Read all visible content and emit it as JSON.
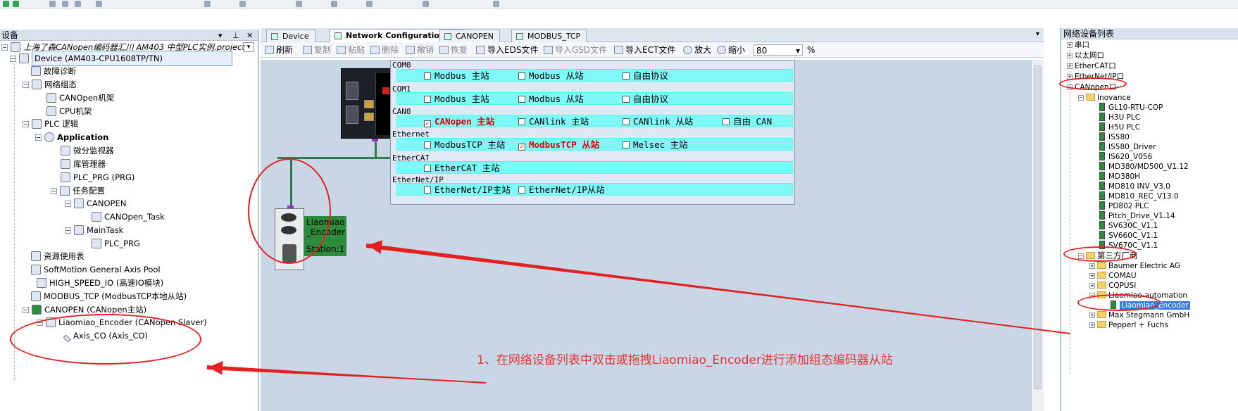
{
  "left": {
    "title": "设备",
    "project": "上海了森CANopen编码器汇川 AM403 中型PLC实例.project",
    "items": [
      {
        "label": "Device (AM403-CPU1608TP/TN)"
      },
      {
        "label": "故障诊断"
      },
      {
        "label": "网络组态"
      },
      {
        "label": "CANOpen机架"
      },
      {
        "label": "CPU机架"
      },
      {
        "label": "PLC 逻辑"
      },
      {
        "label": "Application"
      },
      {
        "label": "微分监视器"
      },
      {
        "label": "库管理器"
      },
      {
        "label": "PLC_PRG (PRG)"
      },
      {
        "label": "任务配置"
      },
      {
        "label": "CANOPEN"
      },
      {
        "label": "CANOpen_Task"
      },
      {
        "label": "MainTask"
      },
      {
        "label": "PLC_PRG"
      },
      {
        "label": "资源使用表"
      },
      {
        "label": "SoftMotion General Axis Pool"
      },
      {
        "label": "HIGH_SPEED_IO (高速IO模块)"
      },
      {
        "label": "MODBUS_TCP (ModbusTCP本地从站)"
      },
      {
        "label": "CANOPEN (CANopen主站)"
      },
      {
        "label": "Liaomiao_Encoder (CANopen Slaver)"
      },
      {
        "label": "Axis_CO (Axis_CO)"
      }
    ]
  },
  "tabs": [
    {
      "label": "Device"
    },
    {
      "label": "Network Configuration"
    },
    {
      "label": "CANOPEN"
    },
    {
      "label": "MODBUS_TCP"
    }
  ],
  "toolbar": {
    "refresh": "刷新",
    "copy": "复制",
    "paste": "粘贴",
    "delete": "删除",
    "undo": "撤销",
    "redo": "恢复",
    "import_eds": "导入EDS文件",
    "import_gsd": "导入GSD文件",
    "import_ect": "导入ECT文件",
    "zoom_in": "放大",
    "zoom_out": "缩小",
    "zoom_value": "80",
    "zoom_unit": "%"
  },
  "config": {
    "com0": {
      "label": "COM0",
      "opts": [
        "Modbus 主站",
        "Modbus 从站",
        "自由协议"
      ]
    },
    "com1": {
      "label": "COM1",
      "opts": [
        "Modbus 主站",
        "Modbus 从站",
        "自由协议"
      ]
    },
    "can0": {
      "label": "CAN0",
      "opts": [
        "CANopen 主站",
        "CANlink 主站",
        "CANlink 从站",
        "自由 CAN"
      ]
    },
    "ethernet": {
      "label": "Ethernet",
      "opts": [
        "ModbusTCP 主站",
        "ModbusTCP 从站",
        "Melsec 主站"
      ]
    },
    "ethercat": {
      "label": "EtherCAT",
      "opts": [
        "EtherCAT 主站"
      ]
    },
    "ethernetip": {
      "label": "EtherNet/IP",
      "opts": [
        "EtherNet/IP主站",
        "EtherNet/IP从站"
      ]
    },
    "check_mark": "✓"
  },
  "encoder": {
    "name": "Liaomiao _Encoder",
    "station": "Station:1"
  },
  "annotation": "1、在网络设备列表中双击或拖拽Liaomiao_Encoder进行添加组态编码器从站",
  "right": {
    "title": "网络设备列表",
    "items": [
      {
        "label": "串口"
      },
      {
        "label": "以太网口"
      },
      {
        "label": "EtherCAT口"
      },
      {
        "label": "EtherNet/IP口"
      },
      {
        "label": "CANopen口"
      },
      {
        "label": "Inovance"
      },
      {
        "label": "GL10-RTU-COP"
      },
      {
        "label": "H3U PLC"
      },
      {
        "label": "H5U PLC"
      },
      {
        "label": "IS580"
      },
      {
        "label": "IS580_Driver"
      },
      {
        "label": "IS620_V056"
      },
      {
        "label": "MD380/MD500_V1.12"
      },
      {
        "label": "MD380H"
      },
      {
        "label": "MD810 INV_V3.0"
      },
      {
        "label": "MD810_REC_V13.0"
      },
      {
        "label": "PD802 PLC"
      },
      {
        "label": "Pitch_Drive_V1.14"
      },
      {
        "label": "SV630C_V1.1"
      },
      {
        "label": "SV660C_V1.1"
      },
      {
        "label": "SV670C_V1.1"
      },
      {
        "label": "第三方厂商"
      },
      {
        "label": "Baumer Electric AG"
      },
      {
        "label": "COMAU"
      },
      {
        "label": "CQPUSI"
      },
      {
        "label": "Liaomiao-automation"
      },
      {
        "label": "Liaomiao_Encoder"
      },
      {
        "label": "Max Stegmann GmbH"
      },
      {
        "label": "Pepperl + Fuchs"
      }
    ]
  },
  "colors": {
    "annotation": "#e62020",
    "cfg_row": "#7ff8f8",
    "canvas": "#c9d6e6"
  }
}
